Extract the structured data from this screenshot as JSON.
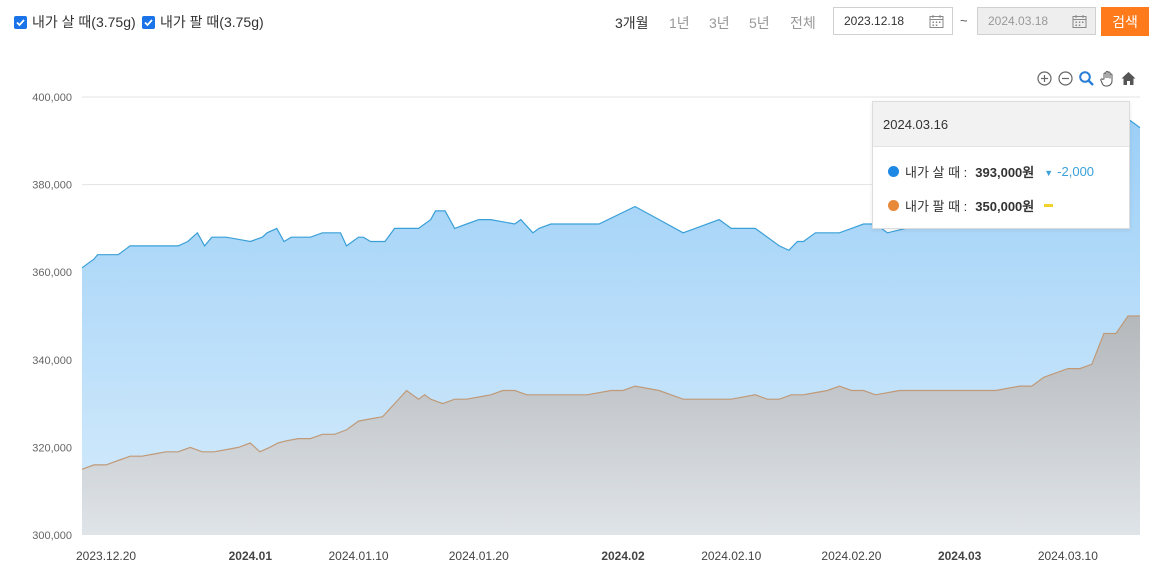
{
  "filters": {
    "buy": {
      "label": "내가 살 때(3.75g)",
      "checked": true
    },
    "sell": {
      "label": "내가 팔 때(3.75g)",
      "checked": true
    }
  },
  "periods": [
    {
      "label": "3개월",
      "active": true
    },
    {
      "label": "1년",
      "active": false
    },
    {
      "label": "3년",
      "active": false
    },
    {
      "label": "5년",
      "active": false
    },
    {
      "label": "전체",
      "active": false
    }
  ],
  "date_range": {
    "start": "2023.12.18",
    "separator": "~",
    "end": "2024.03.18"
  },
  "search_label": "검색",
  "colors": {
    "accent": "#ff7a1a",
    "buy_line": "#3aa0d8",
    "sell_line": "#c09a78",
    "buy_dot": "#1e88e5",
    "sell_dot": "#e8893a",
    "checkbox": "#1a73e8"
  },
  "toolbox_icons": [
    "zoom-in-icon",
    "zoom-out-icon",
    "zoom-area-icon",
    "pan-hand-icon",
    "home-reset-icon"
  ],
  "tooltip": {
    "date": "2024.03.16",
    "rows": [
      {
        "label": "내가 살 때 :",
        "value": "393,000원",
        "change": "-2,000",
        "trend": "down"
      },
      {
        "label": "내가 팔 때 :",
        "value": "350,000원",
        "change": "",
        "trend": "flat"
      }
    ]
  },
  "chart_data": {
    "type": "area",
    "ylim": [
      300000,
      400000
    ],
    "yticks": [
      "300,000",
      "320,000",
      "340,000",
      "360,000",
      "380,000",
      "400,000"
    ],
    "yvalues": [
      300000,
      320000,
      340000,
      360000,
      380000,
      400000
    ],
    "grid": true,
    "xlim": [
      0,
      88
    ],
    "xticks": [
      {
        "label": "2023.12.20",
        "pos": 2,
        "bold": false
      },
      {
        "label": "2024.01",
        "pos": 14,
        "bold": true
      },
      {
        "label": "2024.01.10",
        "pos": 23,
        "bold": false
      },
      {
        "label": "2024.01.20",
        "pos": 33,
        "bold": false
      },
      {
        "label": "2024.02",
        "pos": 45,
        "bold": true
      },
      {
        "label": "2024.02.10",
        "pos": 54,
        "bold": false
      },
      {
        "label": "2024.02.20",
        "pos": 64,
        "bold": false
      },
      {
        "label": "2024.03",
        "pos": 73,
        "bold": true
      },
      {
        "label": "2024.03.10",
        "pos": 82,
        "bold": false
      }
    ],
    "series": [
      {
        "name": "내가 살 때(3.75g)",
        "x": [
          0,
          1,
          1.3,
          3,
          4,
          4.5,
          8,
          8.8,
          9.6,
          10.2,
          10.8,
          12,
          13,
          14,
          15,
          15.4,
          16.2,
          16.8,
          17.4,
          19,
          20,
          20.5,
          21.5,
          22,
          23,
          23.4,
          24,
          24.8,
          25.2,
          26,
          28,
          29,
          29.4,
          30.2,
          31,
          32,
          33,
          34,
          36,
          36.5,
          37.5,
          38,
          39,
          40,
          43,
          46,
          48,
          50,
          51,
          53,
          54,
          56,
          58,
          58.8,
          59.5,
          60,
          61,
          62,
          63,
          64,
          65,
          66,
          67,
          70,
          73,
          76,
          79,
          82,
          84,
          86,
          87,
          88
        ],
        "y": [
          361000,
          363000,
          364000,
          364000,
          366000,
          366000,
          366000,
          367000,
          369000,
          366000,
          368000,
          368000,
          367500,
          367000,
          368000,
          369000,
          370000,
          367000,
          368000,
          368000,
          369000,
          369000,
          369000,
          366000,
          368000,
          368000,
          367000,
          367000,
          367000,
          370000,
          370000,
          372000,
          374000,
          374000,
          370000,
          371000,
          372000,
          372000,
          371000,
          372000,
          369000,
          370000,
          371000,
          371000,
          371000,
          375000,
          372000,
          369000,
          370000,
          372000,
          370000,
          370000,
          366000,
          365000,
          367000,
          367000,
          369000,
          369000,
          369000,
          370000,
          371000,
          371000,
          369000,
          371000,
          372000,
          372000,
          373000,
          374000,
          376000,
          390000,
          395000,
          393000
        ]
      },
      {
        "name": "내가 팔 때(3.75g)",
        "x": [
          0,
          1,
          2,
          3,
          4,
          5,
          6,
          7,
          8,
          9,
          10,
          11,
          12,
          13,
          14,
          14.8,
          15.6,
          16.3,
          17,
          18,
          19,
          20,
          21,
          22,
          22.5,
          23,
          24,
          25,
          26,
          27,
          28,
          28.5,
          29,
          30,
          31,
          32,
          33,
          34,
          35,
          36,
          37,
          38,
          40,
          42,
          44,
          45,
          46,
          48,
          50,
          52,
          54,
          56,
          57,
          58,
          59,
          60,
          61,
          62,
          63,
          64,
          65,
          66,
          68,
          70,
          72,
          74,
          76,
          78,
          79,
          80,
          81,
          82,
          83,
          84,
          85,
          86,
          87,
          88
        ],
        "y": [
          315000,
          316000,
          316000,
          317000,
          318000,
          318000,
          318500,
          319000,
          319000,
          320000,
          319000,
          319000,
          319500,
          320000,
          321000,
          319000,
          320000,
          321000,
          321500,
          322000,
          322000,
          323000,
          323000,
          324000,
          325000,
          326000,
          326500,
          327000,
          330000,
          333000,
          331000,
          332000,
          331000,
          330000,
          331000,
          331000,
          331500,
          332000,
          333000,
          333000,
          332000,
          332000,
          332000,
          332000,
          333000,
          333000,
          334000,
          333000,
          331000,
          331000,
          331000,
          332000,
          331000,
          331000,
          332000,
          332000,
          332500,
          333000,
          334000,
          333000,
          333000,
          332000,
          333000,
          333000,
          333000,
          333000,
          333000,
          334000,
          334000,
          336000,
          337000,
          338000,
          338000,
          339000,
          346000,
          346000,
          350000,
          350000
        ]
      }
    ]
  }
}
